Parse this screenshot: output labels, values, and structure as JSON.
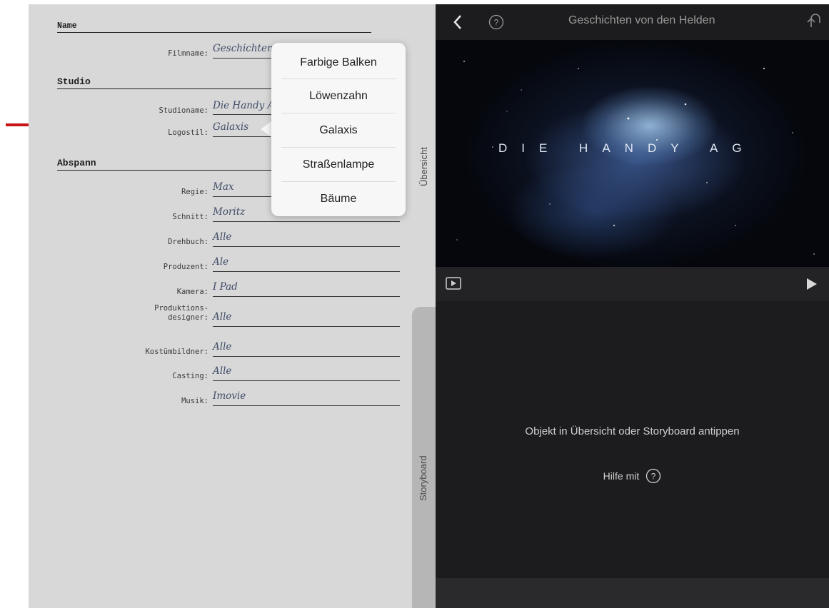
{
  "form": {
    "name_heading": "Name",
    "studio_heading": "Studio",
    "credits_heading": "Abspann",
    "fields": {
      "filmname": {
        "label": "Filmname:",
        "value": "Geschichten"
      },
      "studioname": {
        "label": "Studioname:",
        "value": "Die Handy AG"
      },
      "logostil": {
        "label": "Logostil:",
        "value": "Galaxis"
      }
    },
    "credits": [
      {
        "label": "Regie:",
        "value": "Max"
      },
      {
        "label": "Schnitt:",
        "value": "Moritz"
      },
      {
        "label": "Drehbuch:",
        "value": "Alle"
      },
      {
        "label": "Produzent:",
        "value": "Ale"
      },
      {
        "label": "Kamera:",
        "value": "I Pad"
      },
      {
        "label": "Produktions-\ndesigner:",
        "value": "Alle"
      },
      {
        "label": "Kostümbildner:",
        "value": "Alle"
      },
      {
        "label": "Casting:",
        "value": "Alle"
      },
      {
        "label": "Musik:",
        "value": "Imovie"
      }
    ]
  },
  "popover": {
    "options": [
      "Farbige Balken",
      "Löwenzahn",
      "Galaxis",
      "Straßenlampe",
      "Bäume"
    ],
    "selected": "Galaxis"
  },
  "side_tabs": {
    "overview": "Übersicht",
    "storyboard": "Storyboard"
  },
  "header": {
    "title": "Geschichten von den Helden"
  },
  "preview": {
    "logo_text": "DIE HANDY AG"
  },
  "empty_state": {
    "message": "Objekt in Übersicht oder Storyboard antippen",
    "help_label": "Hilfe mit"
  },
  "icons": {
    "back": "chevron-left-icon",
    "help": "question-circle-icon",
    "undo": "undo-icon",
    "playback_mode": "play-box-icon",
    "play": "play-icon",
    "select_arrows": "updown-chevron-icon",
    "annotation": "red-arrow-icon"
  },
  "colors": {
    "annotation_arrow": "#c81414",
    "paper": "#d8d8d8",
    "dark_panel": "#1c1c1e"
  }
}
